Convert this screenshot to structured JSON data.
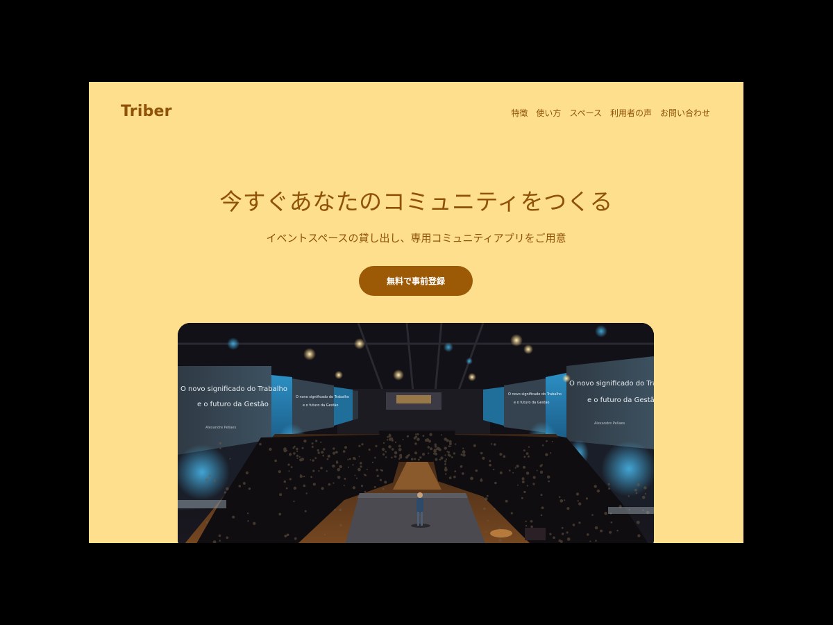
{
  "header": {
    "logo": "Triber",
    "nav": [
      "特徴",
      "使い方",
      "スペース",
      "利用者の声",
      "お問い合わせ"
    ]
  },
  "hero": {
    "title": "今すぐあなたのコミュニティをつくる",
    "subtitle": "イベントスペースの貸し出し、専用コミュニティアプリをご用意",
    "cta_label": "無料で事前登録"
  },
  "photo": {
    "slide_left_line1": "O novo significado do Trabalho",
    "slide_left_line2": "e o futuro da Gestão",
    "slide_right_line1": "O novo significado do Trabalh",
    "slide_right_line2": "e o futuro da Gestão",
    "slide_small_1": "O novo significado do Trabalho",
    "slide_small_2": "e o futuro da Gestão",
    "slide_small_3": "O novo significado do Trabalho",
    "slide_small_4": "e o futuro da Gestão",
    "speaker_left": "Alexandre Pellaes",
    "speaker_right": "Alexandre Pellaes"
  },
  "colors": {
    "page_bg": "#fedf8e",
    "accent": "#8f5207",
    "button_bg": "#9c5a07",
    "outer_bg": "#000000"
  }
}
